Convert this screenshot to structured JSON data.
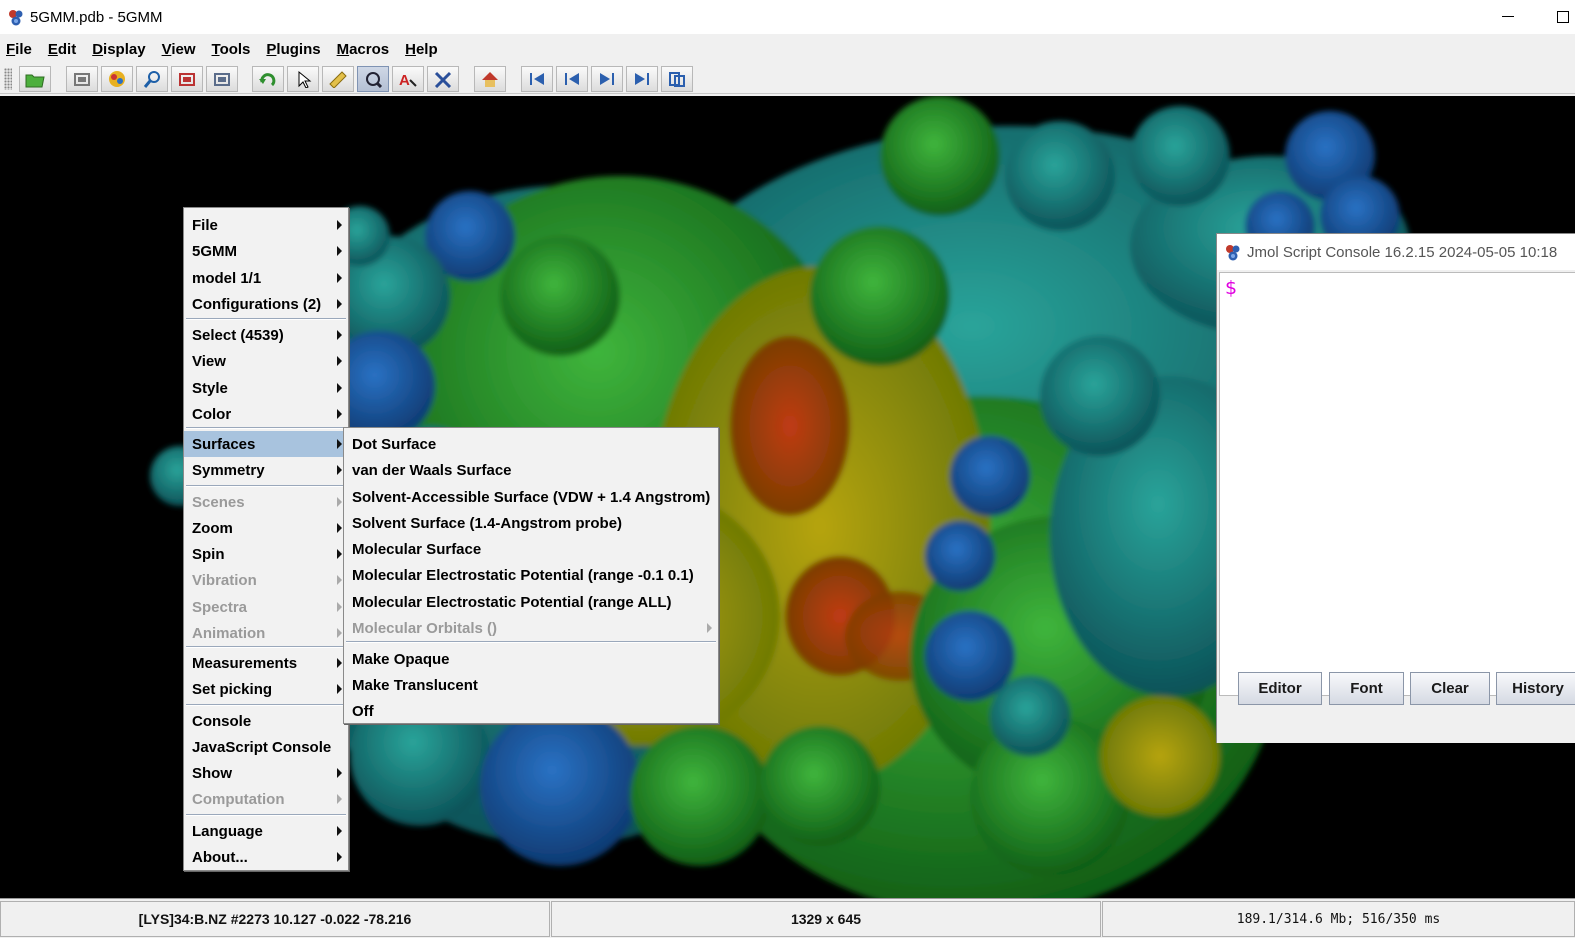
{
  "window": {
    "title": "5GMM.pdb - 5GMM"
  },
  "menubar": {
    "items": [
      {
        "underline": "F",
        "rest": "ile"
      },
      {
        "underline": "E",
        "rest": "dit"
      },
      {
        "underline": "D",
        "rest": "isplay"
      },
      {
        "underline": "V",
        "rest": "iew"
      },
      {
        "underline": "T",
        "rest": "ools"
      },
      {
        "underline": "P",
        "rest": "lugins"
      },
      {
        "underline": "M",
        "rest": "acros"
      },
      {
        "underline": "H",
        "rest": "elp"
      }
    ]
  },
  "toolbar": {
    "buttons": [
      "open-icon",
      "screenshot-icon",
      "povray-icon",
      "magnifier-icon",
      "export-icon",
      "print-icon",
      "rotate-icon",
      "pick-icon",
      "ruler-icon",
      "zoom-rotate-icon",
      "label-icon",
      "translate-icon",
      "home-icon",
      "first-frame-icon",
      "prev-frame-icon",
      "next-frame-icon",
      "last-frame-icon",
      "rewind-icon"
    ]
  },
  "popup": {
    "items": [
      {
        "label": "File",
        "submenu": true,
        "enabled": true
      },
      {
        "label": "5GMM",
        "submenu": true,
        "enabled": true
      },
      {
        "label": "model 1/1",
        "submenu": true,
        "enabled": true
      },
      {
        "label": "Configurations (2)",
        "submenu": true,
        "enabled": true
      },
      {
        "label": "Select (4539)",
        "submenu": true,
        "enabled": true
      },
      {
        "label": "View",
        "submenu": true,
        "enabled": true
      },
      {
        "label": "Style",
        "submenu": true,
        "enabled": true
      },
      {
        "label": "Color",
        "submenu": true,
        "enabled": true
      },
      {
        "label": "Surfaces",
        "submenu": true,
        "enabled": true,
        "selected": true
      },
      {
        "label": "Symmetry",
        "submenu": true,
        "enabled": true
      },
      {
        "label": "Scenes",
        "submenu": true,
        "enabled": false
      },
      {
        "label": "Zoom",
        "submenu": true,
        "enabled": true
      },
      {
        "label": "Spin",
        "submenu": true,
        "enabled": true
      },
      {
        "label": "Vibration",
        "submenu": true,
        "enabled": false
      },
      {
        "label": "Spectra",
        "submenu": true,
        "enabled": false
      },
      {
        "label": "Animation",
        "submenu": true,
        "enabled": false
      },
      {
        "label": "Measurements",
        "submenu": true,
        "enabled": true
      },
      {
        "label": "Set picking",
        "submenu": true,
        "enabled": true
      },
      {
        "label": "Console",
        "submenu": false,
        "enabled": true
      },
      {
        "label": "JavaScript Console",
        "submenu": false,
        "enabled": true
      },
      {
        "label": "Show",
        "submenu": true,
        "enabled": true
      },
      {
        "label": "Computation",
        "submenu": true,
        "enabled": false
      },
      {
        "label": "Language",
        "submenu": true,
        "enabled": true
      },
      {
        "label": "About...",
        "submenu": true,
        "enabled": true
      }
    ]
  },
  "submenu": {
    "items": [
      {
        "label": "Dot Surface",
        "enabled": true
      },
      {
        "label": "van der Waals Surface",
        "enabled": true
      },
      {
        "label": "Solvent-Accessible Surface (VDW + 1.4 Angstrom)",
        "enabled": true
      },
      {
        "label": "Solvent Surface (1.4-Angstrom probe)",
        "enabled": true
      },
      {
        "label": "Molecular Surface",
        "enabled": true
      },
      {
        "label": "Molecular Electrostatic Potential (range -0.1 0.1)",
        "enabled": true
      },
      {
        "label": "Molecular Electrostatic Potential (range ALL)",
        "enabled": true
      },
      {
        "label": "Molecular Orbitals ()",
        "enabled": false,
        "submenu": true
      },
      {
        "label": "Make Opaque",
        "enabled": true
      },
      {
        "label": "Make Translucent",
        "enabled": true
      },
      {
        "label": "Off",
        "enabled": true
      }
    ]
  },
  "console": {
    "title": "Jmol Script Console 16.2.15  2024-05-05 10:18",
    "prompt": "$",
    "buttons": [
      "Editor",
      "Font",
      "Clear",
      "History"
    ]
  },
  "status": {
    "atom_info": "[LYS]34:B.NZ #2273 10.127 -0.022 -78.216",
    "size": "1329 x 645",
    "memory": "189.1/314.6 Mb; 516/350 ms"
  }
}
